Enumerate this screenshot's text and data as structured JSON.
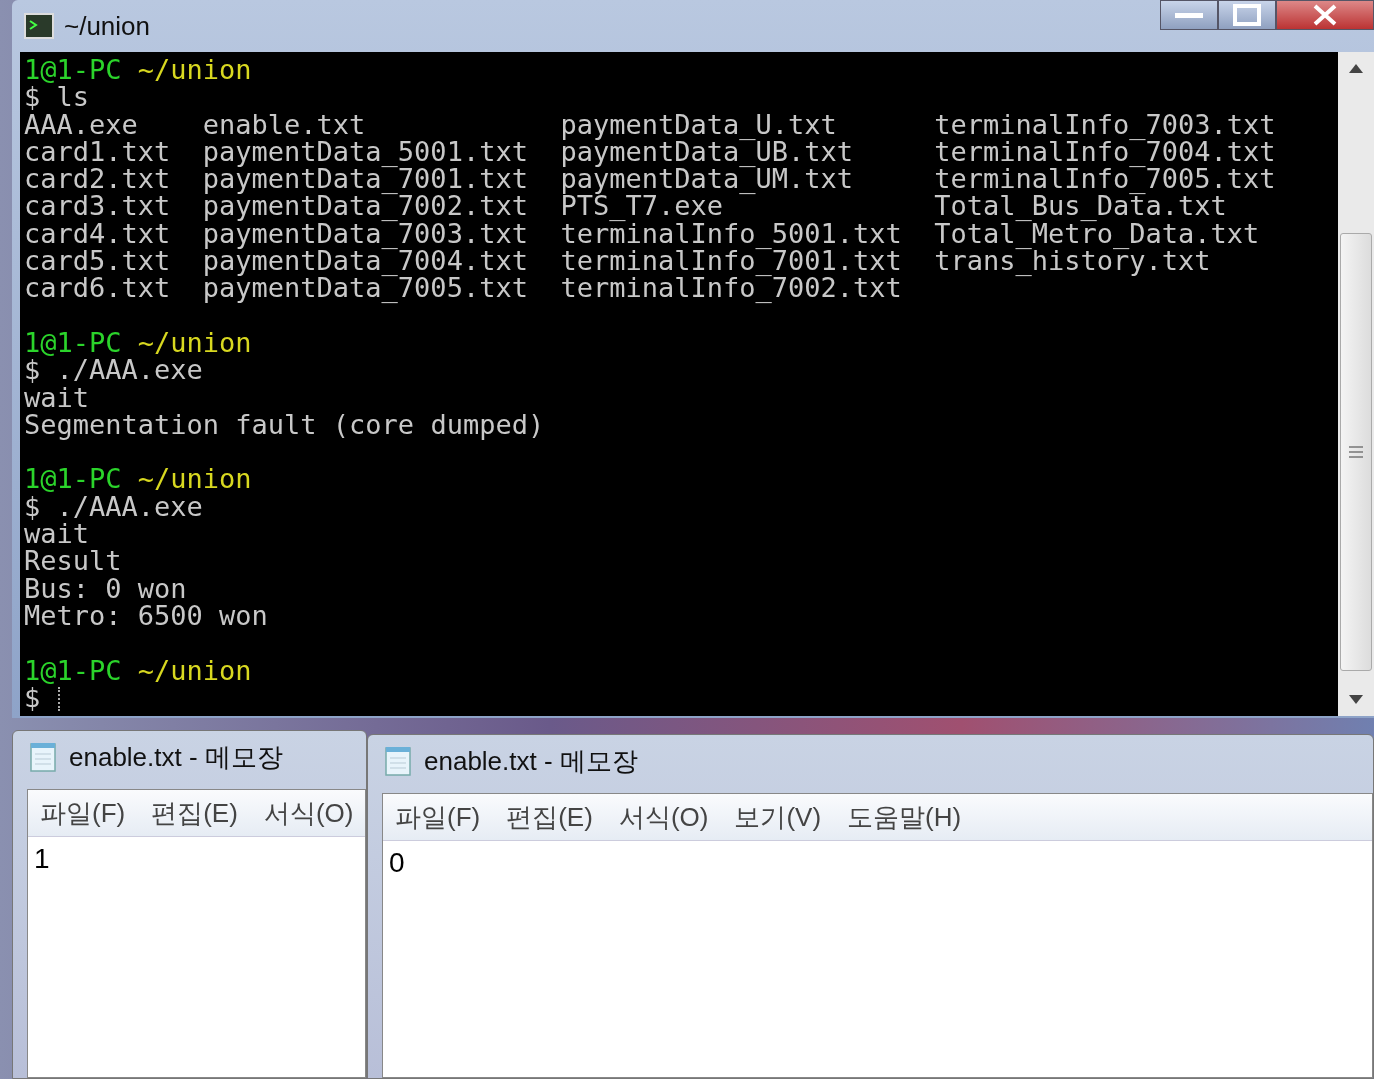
{
  "terminal": {
    "title": "~/union",
    "lines": [
      {
        "kind": "prompt",
        "user": "1@1-PC",
        "path": "~/union"
      },
      {
        "kind": "text",
        "text": "$ ls"
      },
      {
        "kind": "listing",
        "columns": [
          [
            "AAA.exe",
            "card1.txt",
            "card2.txt",
            "card3.txt",
            "card4.txt",
            "card5.txt",
            "card6.txt"
          ],
          [
            "enable.txt",
            "paymentData_5001.txt",
            "paymentData_7001.txt",
            "paymentData_7002.txt",
            "paymentData_7003.txt",
            "paymentData_7004.txt",
            "paymentData_7005.txt"
          ],
          [
            "paymentData_U.txt",
            "paymentData_UB.txt",
            "paymentData_UM.txt",
            "PTS_T7.exe",
            "terminalInfo_5001.txt",
            "terminalInfo_7001.txt",
            "terminalInfo_7002.txt"
          ],
          [
            "terminalInfo_7003.txt",
            "terminalInfo_7004.txt",
            "terminalInfo_7005.txt",
            "Total_Bus_Data.txt",
            "Total_Metro_Data.txt",
            "trans_history.txt"
          ]
        ]
      },
      {
        "kind": "blank"
      },
      {
        "kind": "prompt",
        "user": "1@1-PC",
        "path": "~/union"
      },
      {
        "kind": "text",
        "text": "$ ./AAA.exe"
      },
      {
        "kind": "text",
        "text": "wait"
      },
      {
        "kind": "text",
        "text": "Segmentation fault (core dumped)"
      },
      {
        "kind": "blank"
      },
      {
        "kind": "prompt",
        "user": "1@1-PC",
        "path": "~/union"
      },
      {
        "kind": "text",
        "text": "$ ./AAA.exe"
      },
      {
        "kind": "text",
        "text": "wait"
      },
      {
        "kind": "text",
        "text": "Result"
      },
      {
        "kind": "text",
        "text": "Bus: 0 won"
      },
      {
        "kind": "text",
        "text": "Metro: 6500 won"
      },
      {
        "kind": "blank"
      },
      {
        "kind": "prompt",
        "user": "1@1-PC",
        "path": "~/union"
      },
      {
        "kind": "input",
        "text": "$"
      }
    ]
  },
  "notepads": [
    {
      "title": "enable.txt - 메모장",
      "menu": [
        "파일(F)",
        "편집(E)",
        "서식(O)"
      ],
      "content": "1"
    },
    {
      "title": "enable.txt - 메모장",
      "menu": [
        "파일(F)",
        "편집(E)",
        "서식(O)",
        "보기(V)",
        "도움말(H)"
      ],
      "content": "0"
    }
  ]
}
